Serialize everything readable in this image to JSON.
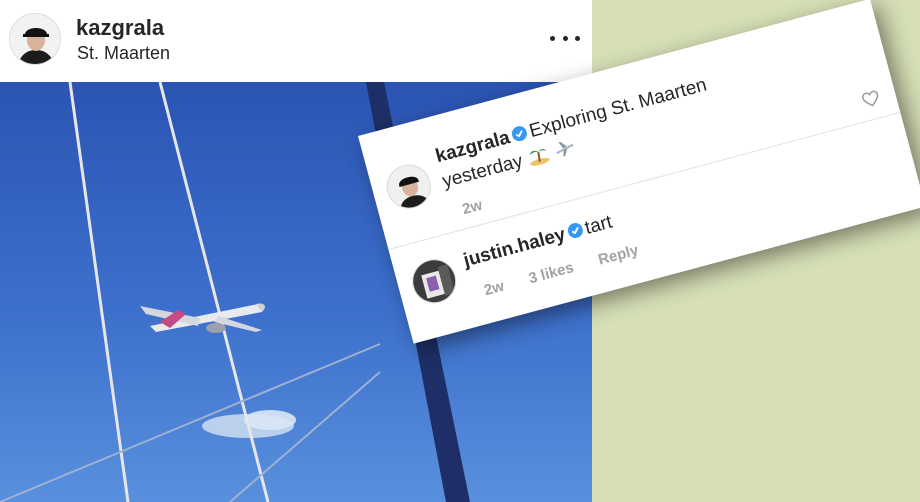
{
  "post": {
    "username": "kazgrala",
    "location": "St. Maarten",
    "more_icon": "more-horizontal-icon",
    "media_description_icon": "airplane-photo"
  },
  "comments": [
    {
      "username": "kazgrala",
      "verified": true,
      "text": "Exploring St. Maarten",
      "text_line2": "yesterday",
      "emojis": [
        "island-emoji",
        "airplane-emoji"
      ],
      "age": "2w",
      "like_icon": "heart-icon"
    },
    {
      "username": "justin.haley",
      "verified": true,
      "text": "tart",
      "age": "2w",
      "likes": "3 likes",
      "reply_label": "Reply"
    }
  ],
  "colors": {
    "background": "#d6dfb6",
    "verified": "#3897f0",
    "meta_text": "#a2a2a2",
    "sky": "#3d70cc"
  }
}
